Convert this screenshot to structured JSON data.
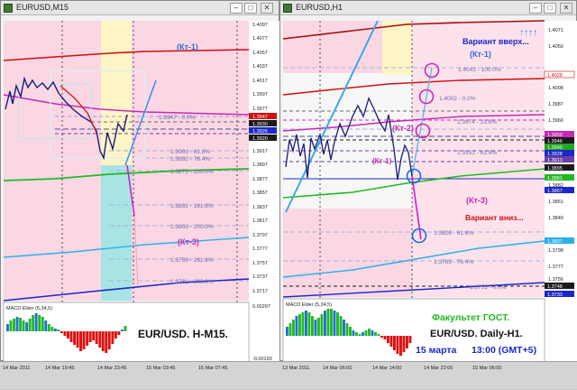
{
  "window1": {
    "title": "EURUSD,M15",
    "price_labels": [
      "1.4097",
      "1.4077",
      "1.4057",
      "1.4037",
      "1.4017",
      "1.3997",
      "1.3977",
      "1.3957",
      "1.3937",
      "1.3917",
      "1.3897",
      "1.3877",
      "1.3857",
      "1.3837",
      "1.3817",
      "1.3797",
      "1.3777",
      "1.3757",
      "1.3737",
      "1.3717"
    ],
    "price_tags": [
      "1.3947",
      "1.3930",
      "1.3926",
      "1.3920"
    ],
    "fibo_levels": [
      "1.3947 - 0.0%",
      "1.3903 - 61.8%",
      "1.3892 - 76.4%",
      "1.3875 - 100.0%",
      "1.3831 - 161.8%",
      "1.3803 - 200.0%",
      "1.3759 - 261.8%",
      "1.3731 - 300.0%"
    ],
    "annotations": {
      "kt1": "(Кт-1)",
      "kt3": "(Кт-3)",
      "main_title": "EUR/USD. H-M15."
    },
    "macd_label": "MACD Elder (5,34,5)",
    "macd_scale": [
      "0.00297",
      "-0.00193"
    ],
    "time_labels": [
      "14 Mar 2011",
      "14 Mar 19:45",
      "14 Mar 23:45",
      "15 Mar 03:45",
      "15 Mar 07:45"
    ]
  },
  "window2": {
    "title": "EURUSD,H1",
    "price_labels": [
      "1.4071",
      "1.4050",
      "1.4029",
      "1.4008",
      "1.3987",
      "1.3966",
      "1.3945",
      "1.3924",
      "1.3903",
      "1.3882",
      "1.3861",
      "1.3840",
      "1.3819",
      "1.3798",
      "1.3777",
      "1.3756",
      "1.3735"
    ],
    "price_tags": [
      "1.4029",
      "1.3950",
      "1.3946",
      "1.3940",
      "1.3928",
      "1.3913",
      "1.3895",
      "1.3881",
      "1.3867",
      "1.3807",
      "1.3748",
      "1.3733"
    ],
    "fibo_levels": [
      "1.4043 - 100.0%",
      "1.4002 - 0.0%",
      "1.3974 - 23.6%",
      "1.3931 - 61.8%",
      "1.3826 - 61.8%",
      "1.3785 - 76.4%",
      "1.3751 - 0.0%"
    ],
    "annotations": {
      "variant_up": "Вариант вверх...",
      "arrows": "↑↑↑↑",
      "kt1_top": "(Кт-1)",
      "kt2": "(Кт-2)",
      "kt1_low": "(Кт-1)",
      "kt3": "(Кт-3)",
      "variant_down": "Вариант вниз...",
      "faculty": "Факультет ГОСТ.",
      "pair": "EUR/USD. Daily-H1.",
      "date": "15 марта",
      "time": "13:00 (GMT+5)"
    },
    "macd_label": "MACD Elder (5,34,5)",
    "time_labels": [
      "13 Mar 2011",
      "14 Mar 06:00",
      "14 Mar 14:00",
      "14 Mar 22:00",
      "15 Mar 06:00"
    ]
  }
}
